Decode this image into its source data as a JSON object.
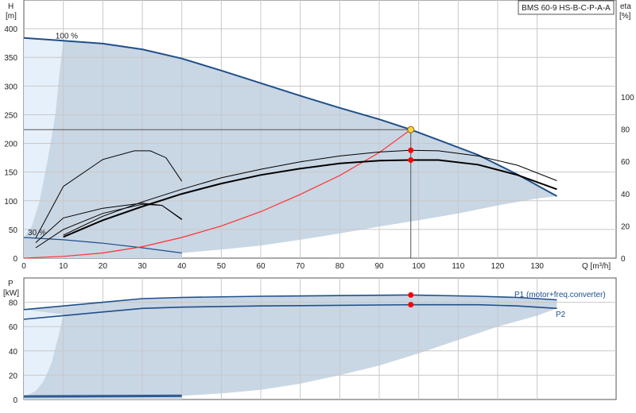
{
  "chart_data": [
    {
      "type": "line",
      "title": "BMS 60-9 HS-B-C-P-A-A",
      "xlabel": "Q [m³/h]",
      "ylabel_top": "H",
      "ylabel_unit": "[m]",
      "y2label_top": "eta",
      "y2label_unit": "[%]",
      "xlim": [
        0,
        150
      ],
      "ylim": [
        0,
        450
      ],
      "y2lim": [
        0,
        160
      ],
      "x_ticks": [
        0,
        10,
        20,
        30,
        40,
        50,
        60,
        70,
        80,
        90,
        100,
        110,
        120,
        130
      ],
      "y_ticks": [
        0,
        50,
        100,
        150,
        200,
        250,
        300,
        350,
        400
      ],
      "y2_ticks": [
        0,
        20,
        40,
        60,
        80,
        100
      ],
      "speed_labels": [
        {
          "text": "100 %",
          "x": 8,
          "y": 383
        },
        {
          "text": "30 %",
          "x": 1,
          "y": 40
        }
      ],
      "operating_region": {
        "upper": [
          [
            0,
            384
          ],
          [
            10,
            379
          ],
          [
            20,
            374
          ],
          [
            30,
            364
          ],
          [
            40,
            348
          ],
          [
            50,
            327
          ],
          [
            60,
            305
          ],
          [
            70,
            283
          ],
          [
            80,
            262
          ],
          [
            90,
            242
          ],
          [
            98,
            224
          ],
          [
            105,
            206
          ],
          [
            115,
            180
          ],
          [
            125,
            146
          ],
          [
            135,
            108
          ]
        ],
        "lower": [
          [
            40,
            9
          ],
          [
            50,
            15
          ],
          [
            60,
            22
          ],
          [
            70,
            32
          ],
          [
            80,
            43
          ],
          [
            90,
            55
          ],
          [
            100,
            66
          ],
          [
            110,
            78
          ],
          [
            120,
            92
          ],
          [
            130,
            104
          ],
          [
            135,
            108
          ]
        ],
        "lower_left": [
          [
            10,
            380
          ],
          [
            9,
            320
          ],
          [
            8,
            250
          ],
          [
            6,
            170
          ],
          [
            4,
            100
          ],
          [
            2,
            55
          ],
          [
            0,
            36
          ]
        ]
      },
      "series": [
        {
          "name": "",
          "role": "pump-curve-100",
          "color": "#1f4f8a",
          "points": [
            [
              0,
              384
            ],
            [
              10,
              379
            ],
            [
              20,
              374
            ],
            [
              30,
              364
            ],
            [
              40,
              348
            ],
            [
              50,
              327
            ],
            [
              60,
              305
            ],
            [
              70,
              283
            ],
            [
              80,
              262
            ],
            [
              90,
              242
            ],
            [
              98,
              224
            ],
            [
              105,
              206
            ],
            [
              115,
              180
            ],
            [
              125,
              146
            ],
            [
              135,
              108
            ]
          ]
        },
        {
          "name": "",
          "role": "pump-curve-30",
          "color": "#1f4f8a",
          "points": [
            [
              0,
              36
            ],
            [
              10,
              32
            ],
            [
              20,
              26
            ],
            [
              30,
              18
            ],
            [
              40,
              9
            ]
          ]
        },
        {
          "name": "",
          "role": "system-curve",
          "color": "#ff3030",
          "points": [
            [
              0,
              0
            ],
            [
              10,
              3
            ],
            [
              20,
              9
            ],
            [
              30,
              20
            ],
            [
              40,
              36
            ],
            [
              50,
              56
            ],
            [
              60,
              81
            ],
            [
              70,
              111
            ],
            [
              80,
              144
            ],
            [
              90,
              184
            ],
            [
              98,
              224
            ]
          ]
        },
        {
          "name": "",
          "role": "eta-total-100",
          "color": "#000000",
          "width": 2,
          "points": [
            [
              10,
              37
            ],
            [
              20,
              66
            ],
            [
              30,
              90
            ],
            [
              40,
              112
            ],
            [
              50,
              130
            ],
            [
              60,
              145
            ],
            [
              70,
              156
            ],
            [
              80,
              165
            ],
            [
              90,
              170
            ],
            [
              98,
              171
            ],
            [
              105,
              171
            ],
            [
              115,
              163
            ],
            [
              125,
              145
            ],
            [
              135,
              120
            ]
          ]
        },
        {
          "name": "",
          "role": "eta-pump-100",
          "color": "#000000",
          "width": 1,
          "points": [
            [
              10,
              40
            ],
            [
              20,
              73
            ],
            [
              30,
              98
            ],
            [
              40,
              120
            ],
            [
              50,
              140
            ],
            [
              60,
              155
            ],
            [
              70,
              168
            ],
            [
              80,
              178
            ],
            [
              90,
              185
            ],
            [
              98,
              188
            ],
            [
              105,
              187
            ],
            [
              115,
              178
            ],
            [
              125,
              162
            ],
            [
              135,
              135
            ]
          ]
        },
        {
          "name": "",
          "role": "eta-total-30",
          "color": "#000000",
          "width": 1,
          "points": [
            [
              3,
              18
            ],
            [
              10,
              50
            ],
            [
              20,
              78
            ],
            [
              30,
              94
            ],
            [
              35,
              92
            ],
            [
              40,
              68
            ]
          ]
        },
        {
          "name": "",
          "role": "eta-pump-30",
          "color": "#000000",
          "width": 1,
          "points": [
            [
              3,
              27
            ],
            [
              10,
              70
            ],
            [
              20,
              87
            ],
            [
              30,
              96
            ],
            [
              35,
              92
            ],
            [
              40,
              67
            ]
          ]
        },
        {
          "name": "",
          "role": "eta-low-speed",
          "color": "#000000",
          "width": 1,
          "points": [
            [
              3,
              35
            ],
            [
              10,
              125
            ],
            [
              20,
              172
            ],
            [
              28,
              187
            ],
            [
              32,
              187
            ],
            [
              36,
              175
            ],
            [
              40,
              134
            ]
          ]
        }
      ],
      "duty_point": {
        "x": 98,
        "y": 224
      },
      "efficiency_points": [
        {
          "x": 98,
          "y": 188
        },
        {
          "x": 98,
          "y": 171
        }
      ],
      "reference_lines": {
        "h": 224,
        "x": 98
      },
      "grid": true
    },
    {
      "type": "line",
      "ylabel_top": "P",
      "ylabel_unit": "[kW]",
      "xlim": [
        0,
        150
      ],
      "ylim": [
        0,
        100
      ],
      "y_ticks": [
        0,
        20,
        40,
        60,
        80
      ],
      "operating_region": {
        "upper": [
          [
            0,
            74
          ],
          [
            10,
            77
          ],
          [
            20,
            80
          ],
          [
            30,
            83
          ],
          [
            40,
            84
          ],
          [
            60,
            85
          ],
          [
            98,
            86
          ],
          [
            115,
            85
          ],
          [
            125,
            84
          ],
          [
            135,
            82
          ]
        ],
        "lower": [
          [
            40,
            3
          ],
          [
            50,
            5
          ],
          [
            60,
            8
          ],
          [
            70,
            13
          ],
          [
            80,
            20
          ],
          [
            90,
            28
          ],
          [
            100,
            38
          ],
          [
            110,
            49
          ],
          [
            120,
            60
          ],
          [
            130,
            69
          ],
          [
            135,
            75
          ]
        ],
        "lower_left": [
          [
            10,
            70
          ],
          [
            9,
            55
          ],
          [
            7,
            30
          ],
          [
            5,
            15
          ],
          [
            3,
            7
          ],
          [
            0,
            2
          ]
        ]
      },
      "series": [
        {
          "name": "P1 (motor+freq.converter)",
          "color": "#1f4f8a",
          "points": [
            [
              0,
              74
            ],
            [
              10,
              77
            ],
            [
              20,
              80
            ],
            [
              30,
              83
            ],
            [
              40,
              84
            ],
            [
              60,
              85
            ],
            [
              98,
              86
            ],
            [
              115,
              85
            ],
            [
              125,
              84
            ],
            [
              135,
              82
            ]
          ]
        },
        {
          "name": "P2",
          "color": "#1f4f8a",
          "points": [
            [
              0,
              66
            ],
            [
              10,
              69
            ],
            [
              20,
              72
            ],
            [
              30,
              75
            ],
            [
              40,
              76
            ],
            [
              60,
              77
            ],
            [
              98,
              78
            ],
            [
              115,
              78
            ],
            [
              125,
              77
            ],
            [
              135,
              75
            ]
          ]
        },
        {
          "name": "",
          "role": "P1-30",
          "color": "#1f4f8a",
          "points": [
            [
              0,
              3
            ],
            [
              40,
              3.5
            ]
          ]
        },
        {
          "name": "",
          "role": "P2-30",
          "color": "#1f4f8a",
          "points": [
            [
              0,
              2
            ],
            [
              40,
              2.5
            ]
          ]
        }
      ],
      "duty_points": [
        {
          "x": 98,
          "y": 86
        },
        {
          "x": 98,
          "y": 78
        }
      ],
      "grid": true
    }
  ],
  "colors": {
    "region_fill": "#c9d6e4",
    "region_light": "#e6f0fb",
    "grid": "#c8c8c8",
    "curve": "#1f4f8a",
    "duty_red": "#ff0000",
    "duty_yellow": "#ffd24a"
  }
}
